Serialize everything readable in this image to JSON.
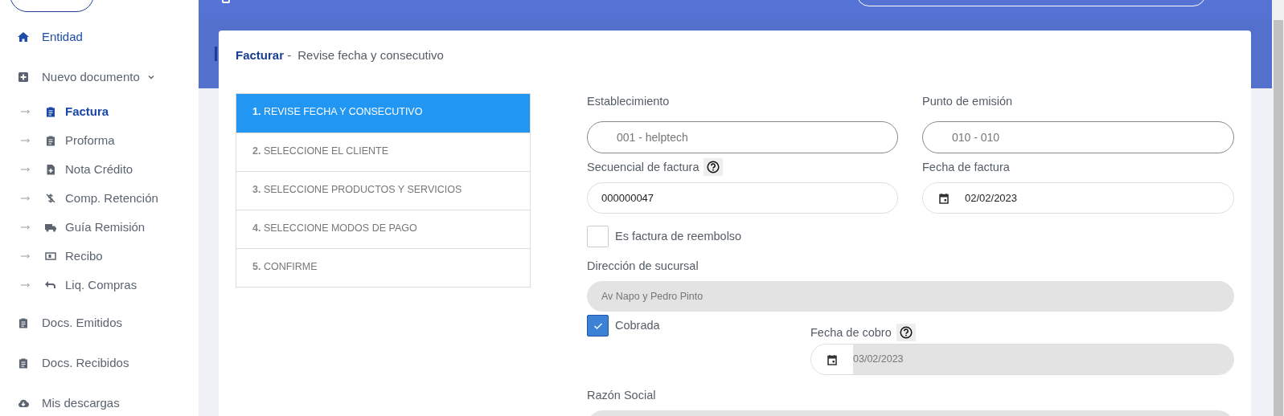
{
  "sidebar": {
    "items": [
      {
        "label": "Entidad",
        "selected": true
      },
      {
        "label": "Nuevo documento",
        "selected": false,
        "expanded": true,
        "children": [
          {
            "label": "Factura",
            "selected": true
          },
          {
            "label": "Proforma",
            "selected": false
          },
          {
            "label": "Nota Crédito",
            "selected": false
          },
          {
            "label": "Comp. Retención",
            "selected": false
          },
          {
            "label": "Guía Remisión",
            "selected": false
          },
          {
            "label": "Recibo",
            "selected": false
          },
          {
            "label": "Liq. Compras",
            "selected": false
          }
        ]
      },
      {
        "label": "Docs. Emitidos",
        "selected": false
      },
      {
        "label": "Docs. Recibidos",
        "selected": false
      },
      {
        "label": "Mis descargas",
        "selected": false
      }
    ]
  },
  "card": {
    "title": "**Facturar** -",
    "subtitle": "Revise fecha y consecutivo"
  },
  "steps": [
    {
      "number": "1.",
      "label": "REVISE FECHA Y CONSECUTIVO",
      "selected": true
    },
    {
      "number": "2.",
      "label": "SELECCIONE EL CLIENTE",
      "selected": false
    },
    {
      "number": "3.",
      "label": "SELECCIONE PRODUCTOS Y SERVICIOS",
      "selected": false
    },
    {
      "number": "4.",
      "label": "SELECCIONE MODOS DE PAGO",
      "selected": false
    },
    {
      "number": "5.",
      "label": "CONFIRME",
      "selected": false
    }
  ],
  "form": {
    "establecimiento": {
      "label": "Establecimiento",
      "value": "001 - helptech"
    },
    "punto_emision": {
      "label": "Punto de emisión",
      "value": "010 - 010"
    },
    "secuencial": {
      "label": "Secuencial de factura",
      "value": "000000047",
      "help": true
    },
    "fecha_factura": {
      "label": "Fecha de factura",
      "value": "02/02/2023"
    },
    "reembolso": {
      "label": "Es factura de reembolso",
      "checked": false
    },
    "direccion": {
      "label": "Dirección de sucursal",
      "value": "Av Napo y Pedro Pinto",
      "disabled": true
    },
    "cobrada": {
      "label": "Cobrada",
      "checked": true
    },
    "fecha_cobro": {
      "label": "Fecha de cobro",
      "value": "03/02/2023",
      "help": true,
      "disabled": true
    },
    "razon_social": {
      "label": "Razón Social",
      "disabled": true
    }
  }
}
